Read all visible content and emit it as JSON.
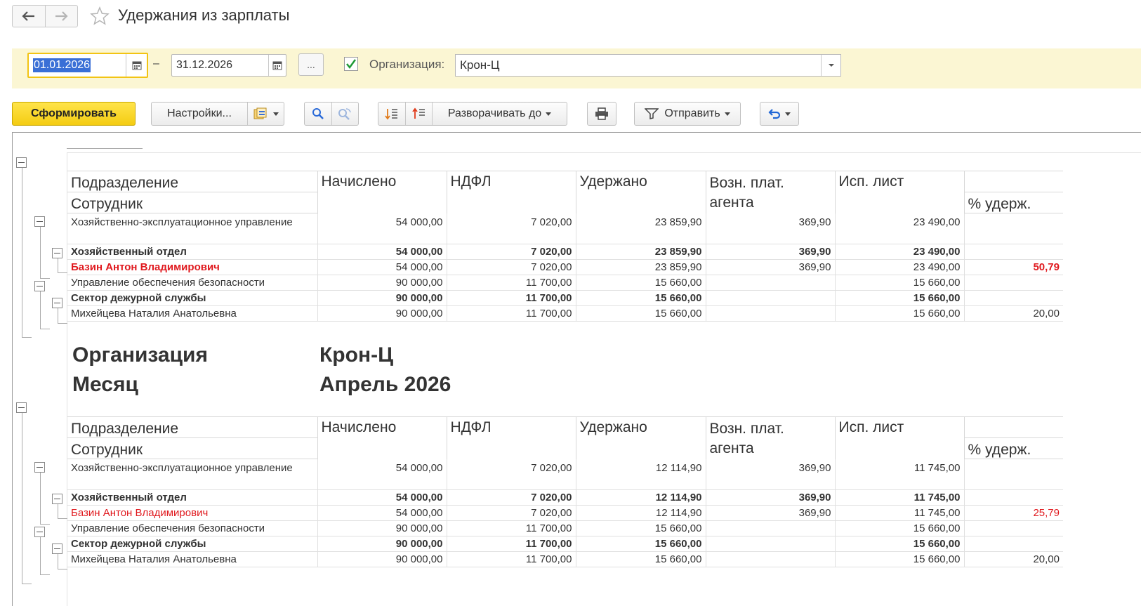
{
  "window": {
    "title": "Удержания из зарплаты"
  },
  "filters": {
    "date_from": "01.01.2026",
    "date_to": "31.12.2026",
    "dash": "–",
    "more_label": "...",
    "org_checked": true,
    "org_label": "Организация:",
    "org_value": "Крон-Ц"
  },
  "toolbar": {
    "generate_label": "Сформировать",
    "settings_label": "Настройки...",
    "expand_label": "Разворачивать до",
    "send_label": "Отправить"
  },
  "report": {
    "headers": {
      "dept": "Подразделение",
      "employee": "Сотрудник",
      "accrued": "Начислено",
      "ndfl": "НДФЛ",
      "withheld": "Удержано",
      "agent_fee": "Возн. плат. агента",
      "writ": "Исп. лист",
      "pct": "% удерж."
    },
    "section1": {
      "rows": [
        {
          "name": "Хозяйственно-эксплуатационное управление",
          "accrued": "54 000,00",
          "ndfl": "7 020,00",
          "withheld": "23 859,90",
          "agent": "369,90",
          "writ": "23 490,00",
          "pct": ""
        },
        {
          "name": "Хозяйственный отдел",
          "accrued": "54 000,00",
          "ndfl": "7 020,00",
          "withheld": "23 859,90",
          "agent": "369,90",
          "writ": "23 490,00",
          "pct": ""
        },
        {
          "name": "Базин Антон Владимирович",
          "accrued": "54 000,00",
          "ndfl": "7 020,00",
          "withheld": "23 859,90",
          "agent": "369,90",
          "writ": "23 490,00",
          "pct": "50,79"
        },
        {
          "name": "Управление обеспечения безопасности",
          "accrued": "90 000,00",
          "ndfl": "11 700,00",
          "withheld": "15 660,00",
          "agent": "",
          "writ": "15 660,00",
          "pct": ""
        },
        {
          "name": "Сектор дежурной службы",
          "accrued": "90 000,00",
          "ndfl": "11 700,00",
          "withheld": "15 660,00",
          "agent": "",
          "writ": "15 660,00",
          "pct": ""
        },
        {
          "name": "Михейцева Наталия Анатольевна",
          "accrued": "90 000,00",
          "ndfl": "11 700,00",
          "withheld": "15 660,00",
          "agent": "",
          "writ": "15 660,00",
          "pct": "20,00"
        }
      ]
    },
    "group2": {
      "org_label": "Организация",
      "org_value": "Крон-Ц",
      "month_label": "Месяц",
      "month_value": "Апрель 2026"
    },
    "section2": {
      "rows": [
        {
          "name": "Хозяйственно-эксплуатационное управление",
          "accrued": "54 000,00",
          "ndfl": "7 020,00",
          "withheld": "12 114,90",
          "agent": "369,90",
          "writ": "11 745,00",
          "pct": ""
        },
        {
          "name": "Хозяйственный отдел",
          "accrued": "54 000,00",
          "ndfl": "7 020,00",
          "withheld": "12 114,90",
          "agent": "369,90",
          "writ": "11 745,00",
          "pct": ""
        },
        {
          "name": "Базин Антон Владимирович",
          "accrued": "54 000,00",
          "ndfl": "7 020,00",
          "withheld": "12 114,90",
          "agent": "369,90",
          "writ": "11 745,00",
          "pct": "25,79"
        },
        {
          "name": "Управление обеспечения безопасности",
          "accrued": "90 000,00",
          "ndfl": "11 700,00",
          "withheld": "15 660,00",
          "agent": "",
          "writ": "15 660,00",
          "pct": ""
        },
        {
          "name": "Сектор дежурной службы",
          "accrued": "90 000,00",
          "ndfl": "11 700,00",
          "withheld": "15 660,00",
          "agent": "",
          "writ": "15 660,00",
          "pct": ""
        },
        {
          "name": "Михейцева Наталия Анатольевна",
          "accrued": "90 000,00",
          "ndfl": "11 700,00",
          "withheld": "15 660,00",
          "agent": "",
          "writ": "15 660,00",
          "pct": "20,00"
        }
      ]
    }
  },
  "colors": {
    "accent_yellow": "#f4cc12",
    "filter_bg": "#fbf6d3",
    "red_text": "#e0191e",
    "selection": "#3a6fd6"
  }
}
